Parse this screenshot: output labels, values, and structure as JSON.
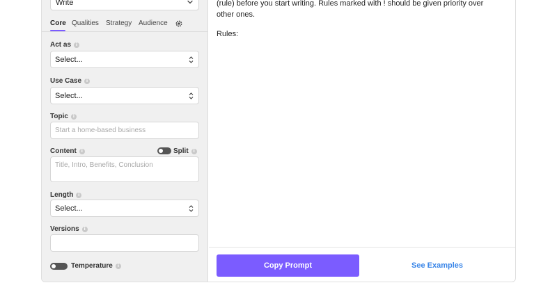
{
  "sidebar": {
    "mode_select": {
      "value": "Write"
    },
    "tabs": [
      {
        "label": "Core",
        "active": true
      },
      {
        "label": "Qualities"
      },
      {
        "label": "Strategy"
      },
      {
        "label": "Audience"
      }
    ],
    "tab_settings_icon": "gear-icon",
    "fields": {
      "act_as": {
        "label": "Act as",
        "value": "Select..."
      },
      "use_case": {
        "label": "Use Case",
        "value": "Select..."
      },
      "topic": {
        "label": "Topic",
        "placeholder": "Start a home-based business"
      },
      "content": {
        "label": "Content",
        "split_label": "Split",
        "placeholder": "Title, Intro, Benefits, Conclusion"
      },
      "length": {
        "label": "Length",
        "value": "Select..."
      },
      "versions": {
        "label": "Versions",
        "value": ""
      },
      "temperature": {
        "label": "Temperature"
      }
    },
    "info_icon": "info-icon"
  },
  "main": {
    "prompt_text": "(rule) before you start writing. Rules marked with ! should be given priority over other ones.",
    "rules_label": "Rules:",
    "copy_button": "Copy Prompt",
    "examples_link": "See Examples"
  },
  "colors": {
    "accent": "#7b5cff",
    "link": "#3a86e8",
    "sidebar_bg": "#f0f0f0"
  }
}
